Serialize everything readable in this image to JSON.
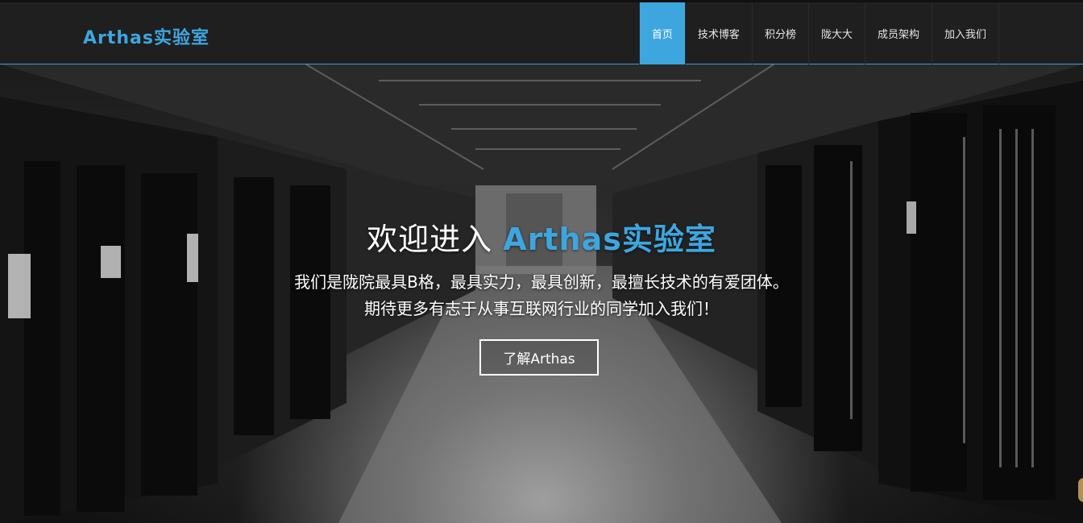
{
  "header": {
    "logo": "Arthas实验室",
    "nav": [
      {
        "label": "首页",
        "active": true
      },
      {
        "label": "技术博客",
        "active": false
      },
      {
        "label": "积分榜",
        "active": false
      },
      {
        "label": "陇大大",
        "active": false
      },
      {
        "label": "成员架构",
        "active": false
      },
      {
        "label": "加入我们",
        "active": false
      }
    ]
  },
  "hero": {
    "title_prefix": "欢迎进入 ",
    "title_brand": "Arthas实验室",
    "line1": "我们是陇院最具B格，最具实力，最具创新，最擅长技术的有爱团体。",
    "line2": "期待更多有志于从事互联网行业的同学加入我们！",
    "cta_label": "了解Arthas",
    "background": "server-room-photo"
  },
  "colors": {
    "accent": "#3ea6df",
    "topbar": "#1f1f1f"
  }
}
